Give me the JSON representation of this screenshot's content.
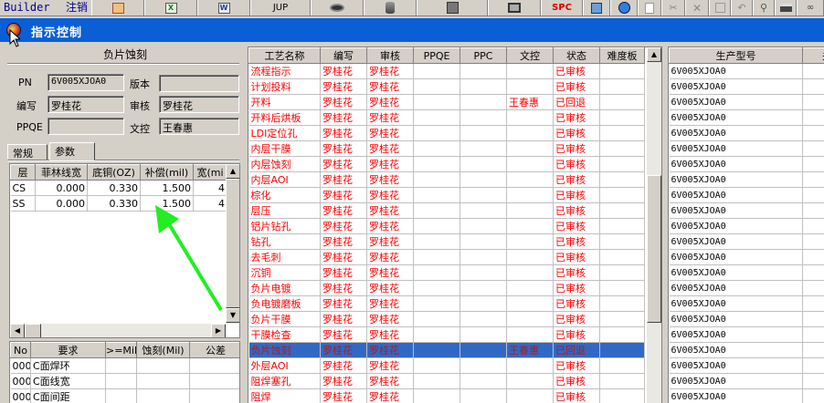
{
  "toolbar": {
    "builder": "Builder",
    "logout": "注销",
    "jup": "JUP",
    "spc": "SPC"
  },
  "window": {
    "title": "指示控制"
  },
  "left": {
    "group_title": "负片蚀刻",
    "pn_label": "PN",
    "pn_value": "6V005XJOA0",
    "version_label": "版本",
    "version_value": "",
    "editor_label": "编写",
    "editor_value": "罗桂花",
    "reviewer_label": "审核",
    "reviewer_value": "罗桂花",
    "ppqe_label": "PPQE",
    "ppqe_value": "",
    "doc_label": "文控",
    "doc_value": "王春惠",
    "tabs": [
      "常规",
      "参数"
    ],
    "param_columns": [
      "层",
      "菲林线宽",
      "底铜(OZ)",
      "补偿(mil)",
      "宽(mi"
    ],
    "param_rows": [
      [
        "CS",
        "0.000",
        "0.330",
        "1.500",
        "4"
      ],
      [
        "SS",
        "0.000",
        "0.330",
        "1.500",
        "4"
      ]
    ],
    "req_columns": [
      "No",
      "要求",
      ">=Mil",
      "蚀刻(Mil)",
      "公差"
    ],
    "req_rows": [
      [
        "000",
        "C面焊环",
        "",
        "",
        ""
      ],
      [
        "000",
        "C面线宽",
        "",
        "",
        ""
      ],
      [
        "000",
        "C面间距",
        "",
        "",
        ""
      ]
    ]
  },
  "process": {
    "columns": [
      "工艺名称",
      "编写",
      "审核",
      "PPQE",
      "PPC",
      "文控",
      "状态",
      "难度板"
    ],
    "rows": [
      [
        "流程指示",
        "罗桂花",
        "罗桂花",
        "",
        "",
        "",
        "已审核",
        ""
      ],
      [
        "计划投料",
        "罗桂花",
        "罗桂花",
        "",
        "",
        "",
        "已审核",
        ""
      ],
      [
        "开料",
        "罗桂花",
        "罗桂花",
        "",
        "",
        "王春惠",
        "已回退",
        ""
      ],
      [
        "开料后烘板",
        "罗桂花",
        "罗桂花",
        "",
        "",
        "",
        "已审核",
        ""
      ],
      [
        "LDI定位孔",
        "罗桂花",
        "罗桂花",
        "",
        "",
        "",
        "已审核",
        ""
      ],
      [
        "内层干膜",
        "罗桂花",
        "罗桂花",
        "",
        "",
        "",
        "已审核",
        ""
      ],
      [
        "内层蚀刻",
        "罗桂花",
        "罗桂花",
        "",
        "",
        "",
        "已审核",
        ""
      ],
      [
        "内层AOI",
        "罗桂花",
        "罗桂花",
        "",
        "",
        "",
        "已审核",
        ""
      ],
      [
        "棕化",
        "罗桂花",
        "罗桂花",
        "",
        "",
        "",
        "已审核",
        ""
      ],
      [
        "层压",
        "罗桂花",
        "罗桂花",
        "",
        "",
        "",
        "已审核",
        ""
      ],
      [
        "铝片钻孔",
        "罗桂花",
        "罗桂花",
        "",
        "",
        "",
        "已审核",
        ""
      ],
      [
        "钻孔",
        "罗桂花",
        "罗桂花",
        "",
        "",
        "",
        "已审核",
        ""
      ],
      [
        "去毛刺",
        "罗桂花",
        "罗桂花",
        "",
        "",
        "",
        "已审核",
        ""
      ],
      [
        "沉铜",
        "罗桂花",
        "罗桂花",
        "",
        "",
        "",
        "已审核",
        ""
      ],
      [
        "负片电镀",
        "罗桂花",
        "罗桂花",
        "",
        "",
        "",
        "已审核",
        ""
      ],
      [
        "负电镀磨板",
        "罗桂花",
        "罗桂花",
        "",
        "",
        "",
        "已审核",
        ""
      ],
      [
        "负片干膜",
        "罗桂花",
        "罗桂花",
        "",
        "",
        "",
        "已审核",
        ""
      ],
      [
        "干膜检查",
        "罗桂花",
        "罗桂花",
        "",
        "",
        "",
        "已审核",
        ""
      ],
      [
        "负片蚀刻",
        "罗桂花",
        "罗桂花",
        "",
        "",
        "王春惠",
        "已回退",
        ""
      ],
      [
        "外层AOI",
        "罗桂花",
        "罗桂花",
        "",
        "",
        "",
        "已审核",
        ""
      ],
      [
        "阻焊塞孔",
        "罗桂花",
        "罗桂花",
        "",
        "",
        "",
        "已审核",
        ""
      ],
      [
        "阻焊",
        "罗桂花",
        "罗桂花",
        "",
        "",
        "",
        "已审核",
        ""
      ]
    ],
    "selected_row": 18
  },
  "model": {
    "columns": [
      "生产型号",
      "关"
    ],
    "rows": [
      "6V005XJOA0",
      "6V005XJOA0",
      "6V005XJOA0",
      "6V005XJOA0",
      "6V005XJOA0",
      "6V005XJOA0",
      "6V005XJOA0",
      "6V005XJOA0",
      "6V005XJOA0",
      "6V005XJOA0",
      "6V005XJOA0",
      "6V005XJOA0",
      "6V005XJOA0",
      "6V005XJOA0",
      "6V005XJOA0",
      "6V005XJOA0",
      "6V005XJOA0",
      "6V005XJOA0",
      "6V005XJOA0",
      "6V005XJOA0",
      "6V005XJOA0",
      "6V005XJOA0"
    ]
  },
  "colors": {
    "title_bar": "#0a5fd6",
    "selection": "#3168c6",
    "status_red": "#ff0000",
    "annotation_arrow": "#22ee22"
  }
}
